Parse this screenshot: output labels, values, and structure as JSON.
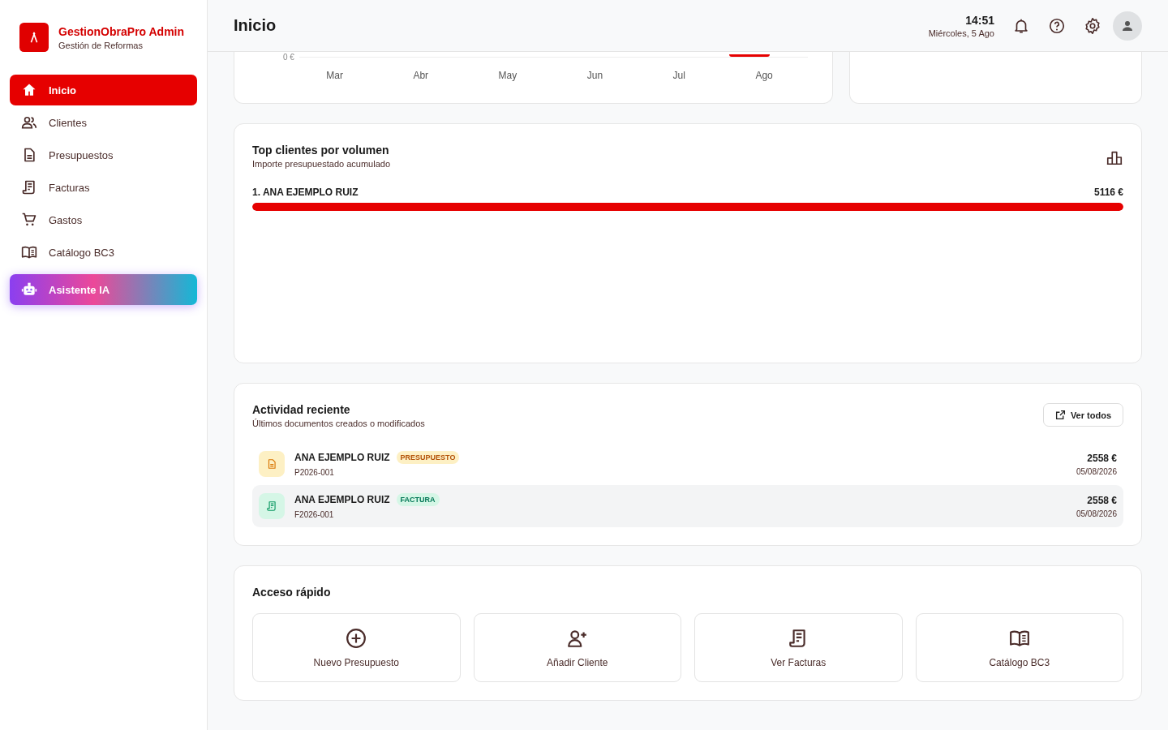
{
  "brand": {
    "title": "GestionObraPro Admin",
    "subtitle": "Gestión de Reformas"
  },
  "sidebar": {
    "items": [
      {
        "label": "Inicio",
        "selected": true,
        "kind": "nav"
      },
      {
        "label": "Clientes",
        "selected": false,
        "kind": "nav"
      },
      {
        "label": "Presupuestos",
        "selected": false,
        "kind": "nav"
      },
      {
        "label": "Facturas",
        "selected": false,
        "kind": "nav"
      },
      {
        "label": "Gastos",
        "selected": false,
        "kind": "nav"
      },
      {
        "label": "Catálogo BC3",
        "selected": false,
        "kind": "nav"
      },
      {
        "label": "Asistente IA",
        "selected": false,
        "kind": "ai"
      }
    ]
  },
  "header": {
    "title": "Inicio",
    "time": "14:51",
    "date": "Miércoles, 5 Ago"
  },
  "chart_card": {
    "y_tick": "0 €",
    "months": [
      "Mar",
      "Abr",
      "May",
      "Jun",
      "Jul",
      "Ago"
    ]
  },
  "top_clients": {
    "title": "Top clientes por volumen",
    "subtitle": "Importe presupuestado acumulado",
    "rows": [
      {
        "name": "1. ANA EJEMPLO RUIZ",
        "amount": "5116 €",
        "level": 1
      }
    ]
  },
  "activity": {
    "title": "Actividad reciente",
    "subtitle": "Últimos documentos creados o modificados",
    "button": "Ver todos",
    "items": [
      {
        "kind": "presupuesto",
        "client": "ANA EJEMPLO RUIZ",
        "badge": "PRESUPUESTO",
        "code": "P2026-001",
        "amount": "2558 €",
        "date": "05/08/2026",
        "selected": false
      },
      {
        "kind": "factura",
        "client": "ANA EJEMPLO RUIZ",
        "badge": "FACTURA",
        "code": "F2026-001",
        "amount": "2558 €",
        "date": "05/08/2026",
        "selected": true
      }
    ]
  },
  "quick_access": {
    "title": "Acceso rápido",
    "items": [
      {
        "label": "Nuevo Presupuesto"
      },
      {
        "label": "Añadir Cliente"
      },
      {
        "label": "Ver Facturas"
      },
      {
        "label": "Catálogo BC3"
      }
    ]
  }
}
